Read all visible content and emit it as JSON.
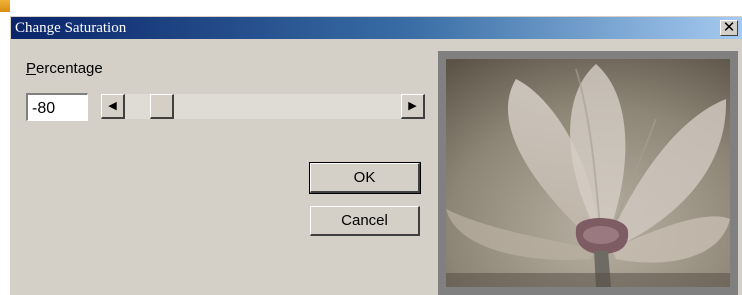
{
  "window": {
    "title": "Change Saturation",
    "close_symbol": "✕"
  },
  "controls": {
    "percentage_label": "Percentage",
    "percentage_value": "-80",
    "slider_level_percent": 10,
    "scroll_left_symbol": "◀",
    "scroll_right_symbol": "▶"
  },
  "buttons": {
    "ok_label": "OK",
    "cancel_label": "Cancel"
  },
  "colors": {
    "dialog_bg": "#d4d0c8",
    "titlebar_start": "#0a246a",
    "titlebar_end": "#a6caf0"
  },
  "icons": {
    "corner": "app-corner-icon",
    "close": "close-icon",
    "scroll_left": "arrow-left-icon",
    "scroll_right": "arrow-right-icon"
  }
}
